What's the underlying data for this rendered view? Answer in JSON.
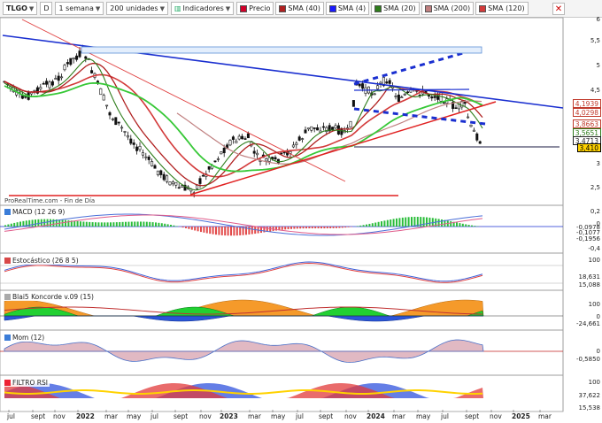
{
  "toolbar": {
    "symbol": "TLGO",
    "period_code": "D",
    "timeframe": "1 semana",
    "units": "200 unidades",
    "indicators": "Indicadores",
    "legend": [
      {
        "label": "Precio",
        "color": "#d1002a"
      },
      {
        "label": "SMA (40)",
        "color": "#b02020"
      },
      {
        "label": "SMA (4)",
        "color": "#1a1aff"
      },
      {
        "label": "SMA (20)",
        "color": "#2e7d1b"
      },
      {
        "label": "SMA (200)",
        "color": "#c08080"
      },
      {
        "label": "SMA (120)",
        "color": "#d33a3a"
      }
    ]
  },
  "watermark": "ProRealTime.com - Fin de Día",
  "panels": {
    "macd": "MACD (12 26 9)",
    "stoch": "Estocástico (26 8 5)",
    "koncorde": "Blai5 Koncorde v.09 (15)",
    "mom": "Mom (12)",
    "rsi": "FILTRO RSI"
  },
  "price_axis": [
    "6",
    "5,5",
    "5",
    "4,5",
    "4",
    "3,5",
    "3",
    "2,5"
  ],
  "price_tags": [
    {
      "text": "4,1939",
      "color": "#c0392b",
      "bg": "#ffffff"
    },
    {
      "text": "4,0298",
      "color": "#c0392b",
      "bg": "#ffffff"
    },
    {
      "text": "3,8663",
      "color": "#c0392b",
      "bg": "#ffffff"
    },
    {
      "text": "3,5651",
      "color": "#2e7d1b",
      "bg": "#ffffff"
    },
    {
      "text": "3,4713",
      "color": "#222222",
      "bg": "#ffffff"
    },
    {
      "text": "3,410",
      "color": "#000000",
      "bg": "#ffd200"
    }
  ],
  "macd_axis": [
    "0,2",
    "0",
    "-0,0978",
    "-0,1077",
    "-0,1956",
    "-0,4"
  ],
  "stoch_axis": [
    "100",
    "18,631",
    "15,088"
  ],
  "koncorde_axis": [
    "100",
    "0",
    "-24,661"
  ],
  "mom_axis": [
    "0",
    "-0,5850"
  ],
  "rsi_axis": [
    "100",
    "37,622",
    "15,538"
  ],
  "time_axis": [
    "jul",
    "sept",
    "nov",
    "2022",
    "mar",
    "may",
    "jul",
    "sept",
    "nov",
    "2023",
    "mar",
    "may",
    "jul",
    "sept",
    "nov",
    "2024",
    "mar",
    "may",
    "jul",
    "sept",
    "nov",
    "2025",
    "mar"
  ]
}
